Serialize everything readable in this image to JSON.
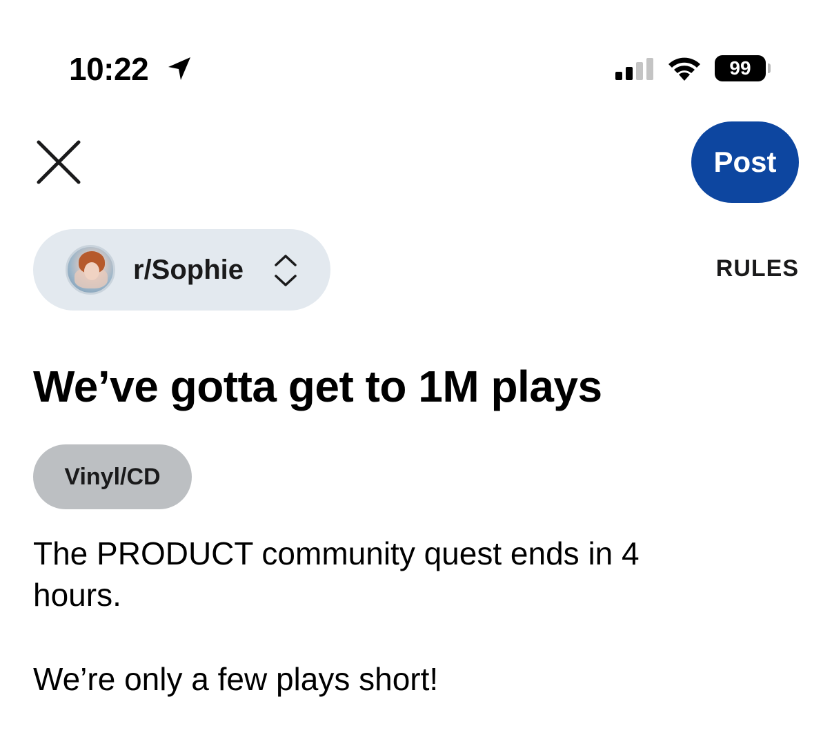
{
  "status_bar": {
    "time": "10:22",
    "battery": "99"
  },
  "header": {
    "close_icon": "close-icon",
    "post_label": "Post"
  },
  "community": {
    "name": "r/Sophie",
    "rules_label": "RULES"
  },
  "post": {
    "title": "We’ve gotta get to 1M plays",
    "flair": "Vinyl/CD",
    "body_line1": "The PRODUCT community quest ends in 4 hours.",
    "body_line2": "We’re only a few plays short!"
  },
  "colors": {
    "post_button": "#0d46a0",
    "community_chip": "#e3e9ef",
    "flair_chip": "#bcbfc2"
  }
}
